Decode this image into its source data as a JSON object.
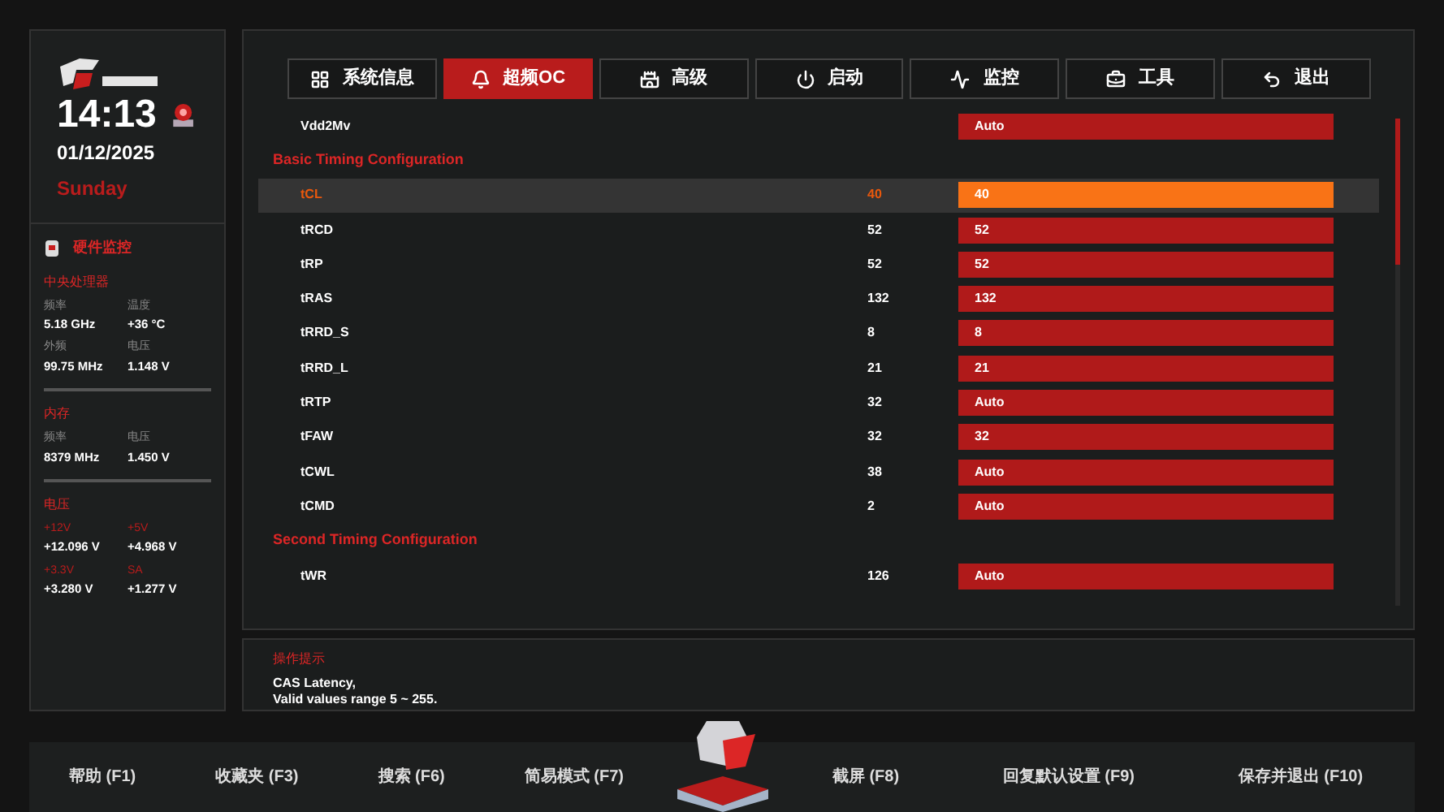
{
  "clock": {
    "time": "14:13",
    "date": "01/12/2025",
    "weekday": "Sunday"
  },
  "monitor": {
    "title": "硬件监控",
    "groups": [
      {
        "title": "中央处理器",
        "items": [
          {
            "label": "频率",
            "value": "5.18 GHz"
          },
          {
            "label": "温度",
            "value": "+36 °C"
          },
          {
            "label": "外频",
            "value": "99.75 MHz"
          },
          {
            "label": "电压",
            "value": "1.148 V"
          }
        ]
      },
      {
        "title": "内存",
        "items": [
          {
            "label": "频率",
            "value": "8379 MHz"
          },
          {
            "label": "电压",
            "value": "1.450 V"
          }
        ]
      },
      {
        "title": "电压",
        "items": [
          {
            "label": "+12V",
            "value": "+12.096 V"
          },
          {
            "label": "+5V",
            "value": "+4.968 V"
          },
          {
            "label": "+3.3V",
            "value": "+3.280 V"
          },
          {
            "label": "SA",
            "value": "+1.277 V"
          }
        ]
      }
    ]
  },
  "tabs": [
    {
      "label": "系统信息",
      "selected": false
    },
    {
      "label": "超频OC",
      "selected": true
    },
    {
      "label": "高级",
      "selected": false
    },
    {
      "label": "启动",
      "selected": false
    },
    {
      "label": "监控",
      "selected": false
    },
    {
      "label": "工具",
      "selected": false
    },
    {
      "label": "退出",
      "selected": false
    }
  ],
  "settings": [
    {
      "kind": "setting",
      "name": "Vdd2Mv",
      "value": "Auto",
      "selected": false
    },
    {
      "kind": "header",
      "name": "Basic Timing Configuration"
    },
    {
      "kind": "setting",
      "name": "tCL",
      "current": "40",
      "value": "40",
      "selected": true
    },
    {
      "kind": "setting",
      "name": "tRCD",
      "current": "52",
      "value": "52",
      "selected": false
    },
    {
      "kind": "setting",
      "name": "tRP",
      "current": "52",
      "value": "52",
      "selected": false
    },
    {
      "kind": "setting",
      "name": "tRAS",
      "current": "132",
      "value": "132",
      "selected": false
    },
    {
      "kind": "setting",
      "name": "tRRD_S",
      "current": "8",
      "value": "8",
      "selected": false
    },
    {
      "kind": "setting",
      "name": "tRRD_L",
      "current": "21",
      "value": "21",
      "selected": false
    },
    {
      "kind": "setting",
      "name": "tRTP",
      "current": "32",
      "value": "Auto",
      "selected": false
    },
    {
      "kind": "setting",
      "name": "tFAW",
      "current": "32",
      "value": "32",
      "selected": false
    },
    {
      "kind": "setting",
      "name": "tCWL",
      "current": "38",
      "value": "Auto",
      "selected": false
    },
    {
      "kind": "setting",
      "name": "tCMD",
      "current": "2",
      "value": "Auto",
      "selected": false
    },
    {
      "kind": "header",
      "name": "Second Timing Configuration"
    },
    {
      "kind": "setting",
      "name": "tWR",
      "current": "126",
      "value": "Auto",
      "selected": false
    }
  ],
  "help": {
    "title": "操作提示",
    "lines": [
      "CAS Latency,",
      "Valid values range 5 ~ 255."
    ]
  },
  "footer": {
    "left": [
      "帮助 (F1)",
      "收藏夹 (F3)",
      "搜索 (F6)",
      "简易模式 (F7)"
    ],
    "right": [
      "截屏 (F8)",
      "回复默认设置 (F9)",
      "保存并退出 (F10)"
    ]
  }
}
